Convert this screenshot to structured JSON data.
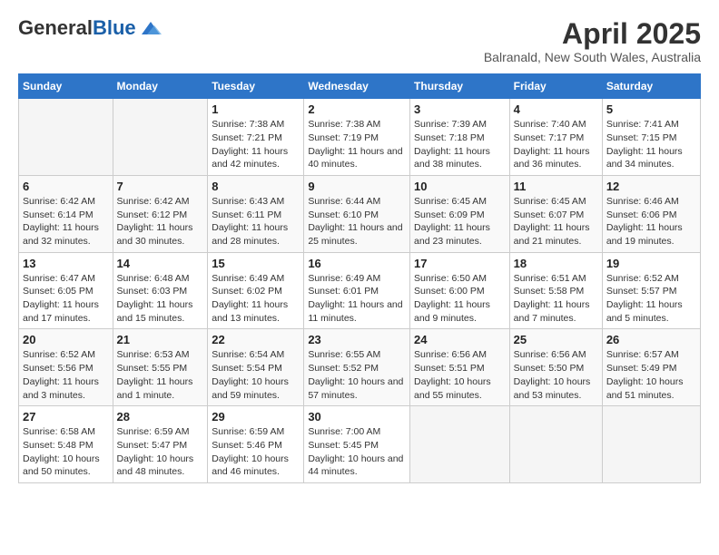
{
  "header": {
    "logo_general": "General",
    "logo_blue": "Blue",
    "month": "April 2025",
    "location": "Balranald, New South Wales, Australia"
  },
  "days_of_week": [
    "Sunday",
    "Monday",
    "Tuesday",
    "Wednesday",
    "Thursday",
    "Friday",
    "Saturday"
  ],
  "weeks": [
    [
      {
        "day": "",
        "sunrise": "",
        "sunset": "",
        "daylight": ""
      },
      {
        "day": "",
        "sunrise": "",
        "sunset": "",
        "daylight": ""
      },
      {
        "day": "1",
        "sunrise": "Sunrise: 7:38 AM",
        "sunset": "Sunset: 7:21 PM",
        "daylight": "Daylight: 11 hours and 42 minutes."
      },
      {
        "day": "2",
        "sunrise": "Sunrise: 7:38 AM",
        "sunset": "Sunset: 7:19 PM",
        "daylight": "Daylight: 11 hours and 40 minutes."
      },
      {
        "day": "3",
        "sunrise": "Sunrise: 7:39 AM",
        "sunset": "Sunset: 7:18 PM",
        "daylight": "Daylight: 11 hours and 38 minutes."
      },
      {
        "day": "4",
        "sunrise": "Sunrise: 7:40 AM",
        "sunset": "Sunset: 7:17 PM",
        "daylight": "Daylight: 11 hours and 36 minutes."
      },
      {
        "day": "5",
        "sunrise": "Sunrise: 7:41 AM",
        "sunset": "Sunset: 7:15 PM",
        "daylight": "Daylight: 11 hours and 34 minutes."
      }
    ],
    [
      {
        "day": "6",
        "sunrise": "Sunrise: 6:42 AM",
        "sunset": "Sunset: 6:14 PM",
        "daylight": "Daylight: 11 hours and 32 minutes."
      },
      {
        "day": "7",
        "sunrise": "Sunrise: 6:42 AM",
        "sunset": "Sunset: 6:12 PM",
        "daylight": "Daylight: 11 hours and 30 minutes."
      },
      {
        "day": "8",
        "sunrise": "Sunrise: 6:43 AM",
        "sunset": "Sunset: 6:11 PM",
        "daylight": "Daylight: 11 hours and 28 minutes."
      },
      {
        "day": "9",
        "sunrise": "Sunrise: 6:44 AM",
        "sunset": "Sunset: 6:10 PM",
        "daylight": "Daylight: 11 hours and 25 minutes."
      },
      {
        "day": "10",
        "sunrise": "Sunrise: 6:45 AM",
        "sunset": "Sunset: 6:09 PM",
        "daylight": "Daylight: 11 hours and 23 minutes."
      },
      {
        "day": "11",
        "sunrise": "Sunrise: 6:45 AM",
        "sunset": "Sunset: 6:07 PM",
        "daylight": "Daylight: 11 hours and 21 minutes."
      },
      {
        "day": "12",
        "sunrise": "Sunrise: 6:46 AM",
        "sunset": "Sunset: 6:06 PM",
        "daylight": "Daylight: 11 hours and 19 minutes."
      }
    ],
    [
      {
        "day": "13",
        "sunrise": "Sunrise: 6:47 AM",
        "sunset": "Sunset: 6:05 PM",
        "daylight": "Daylight: 11 hours and 17 minutes."
      },
      {
        "day": "14",
        "sunrise": "Sunrise: 6:48 AM",
        "sunset": "Sunset: 6:03 PM",
        "daylight": "Daylight: 11 hours and 15 minutes."
      },
      {
        "day": "15",
        "sunrise": "Sunrise: 6:49 AM",
        "sunset": "Sunset: 6:02 PM",
        "daylight": "Daylight: 11 hours and 13 minutes."
      },
      {
        "day": "16",
        "sunrise": "Sunrise: 6:49 AM",
        "sunset": "Sunset: 6:01 PM",
        "daylight": "Daylight: 11 hours and 11 minutes."
      },
      {
        "day": "17",
        "sunrise": "Sunrise: 6:50 AM",
        "sunset": "Sunset: 6:00 PM",
        "daylight": "Daylight: 11 hours and 9 minutes."
      },
      {
        "day": "18",
        "sunrise": "Sunrise: 6:51 AM",
        "sunset": "Sunset: 5:58 PM",
        "daylight": "Daylight: 11 hours and 7 minutes."
      },
      {
        "day": "19",
        "sunrise": "Sunrise: 6:52 AM",
        "sunset": "Sunset: 5:57 PM",
        "daylight": "Daylight: 11 hours and 5 minutes."
      }
    ],
    [
      {
        "day": "20",
        "sunrise": "Sunrise: 6:52 AM",
        "sunset": "Sunset: 5:56 PM",
        "daylight": "Daylight: 11 hours and 3 minutes."
      },
      {
        "day": "21",
        "sunrise": "Sunrise: 6:53 AM",
        "sunset": "Sunset: 5:55 PM",
        "daylight": "Daylight: 11 hours and 1 minute."
      },
      {
        "day": "22",
        "sunrise": "Sunrise: 6:54 AM",
        "sunset": "Sunset: 5:54 PM",
        "daylight": "Daylight: 10 hours and 59 minutes."
      },
      {
        "day": "23",
        "sunrise": "Sunrise: 6:55 AM",
        "sunset": "Sunset: 5:52 PM",
        "daylight": "Daylight: 10 hours and 57 minutes."
      },
      {
        "day": "24",
        "sunrise": "Sunrise: 6:56 AM",
        "sunset": "Sunset: 5:51 PM",
        "daylight": "Daylight: 10 hours and 55 minutes."
      },
      {
        "day": "25",
        "sunrise": "Sunrise: 6:56 AM",
        "sunset": "Sunset: 5:50 PM",
        "daylight": "Daylight: 10 hours and 53 minutes."
      },
      {
        "day": "26",
        "sunrise": "Sunrise: 6:57 AM",
        "sunset": "Sunset: 5:49 PM",
        "daylight": "Daylight: 10 hours and 51 minutes."
      }
    ],
    [
      {
        "day": "27",
        "sunrise": "Sunrise: 6:58 AM",
        "sunset": "Sunset: 5:48 PM",
        "daylight": "Daylight: 10 hours and 50 minutes."
      },
      {
        "day": "28",
        "sunrise": "Sunrise: 6:59 AM",
        "sunset": "Sunset: 5:47 PM",
        "daylight": "Daylight: 10 hours and 48 minutes."
      },
      {
        "day": "29",
        "sunrise": "Sunrise: 6:59 AM",
        "sunset": "Sunset: 5:46 PM",
        "daylight": "Daylight: 10 hours and 46 minutes."
      },
      {
        "day": "30",
        "sunrise": "Sunrise: 7:00 AM",
        "sunset": "Sunset: 5:45 PM",
        "daylight": "Daylight: 10 hours and 44 minutes."
      },
      {
        "day": "",
        "sunrise": "",
        "sunset": "",
        "daylight": ""
      },
      {
        "day": "",
        "sunrise": "",
        "sunset": "",
        "daylight": ""
      },
      {
        "day": "",
        "sunrise": "",
        "sunset": "",
        "daylight": ""
      }
    ]
  ]
}
